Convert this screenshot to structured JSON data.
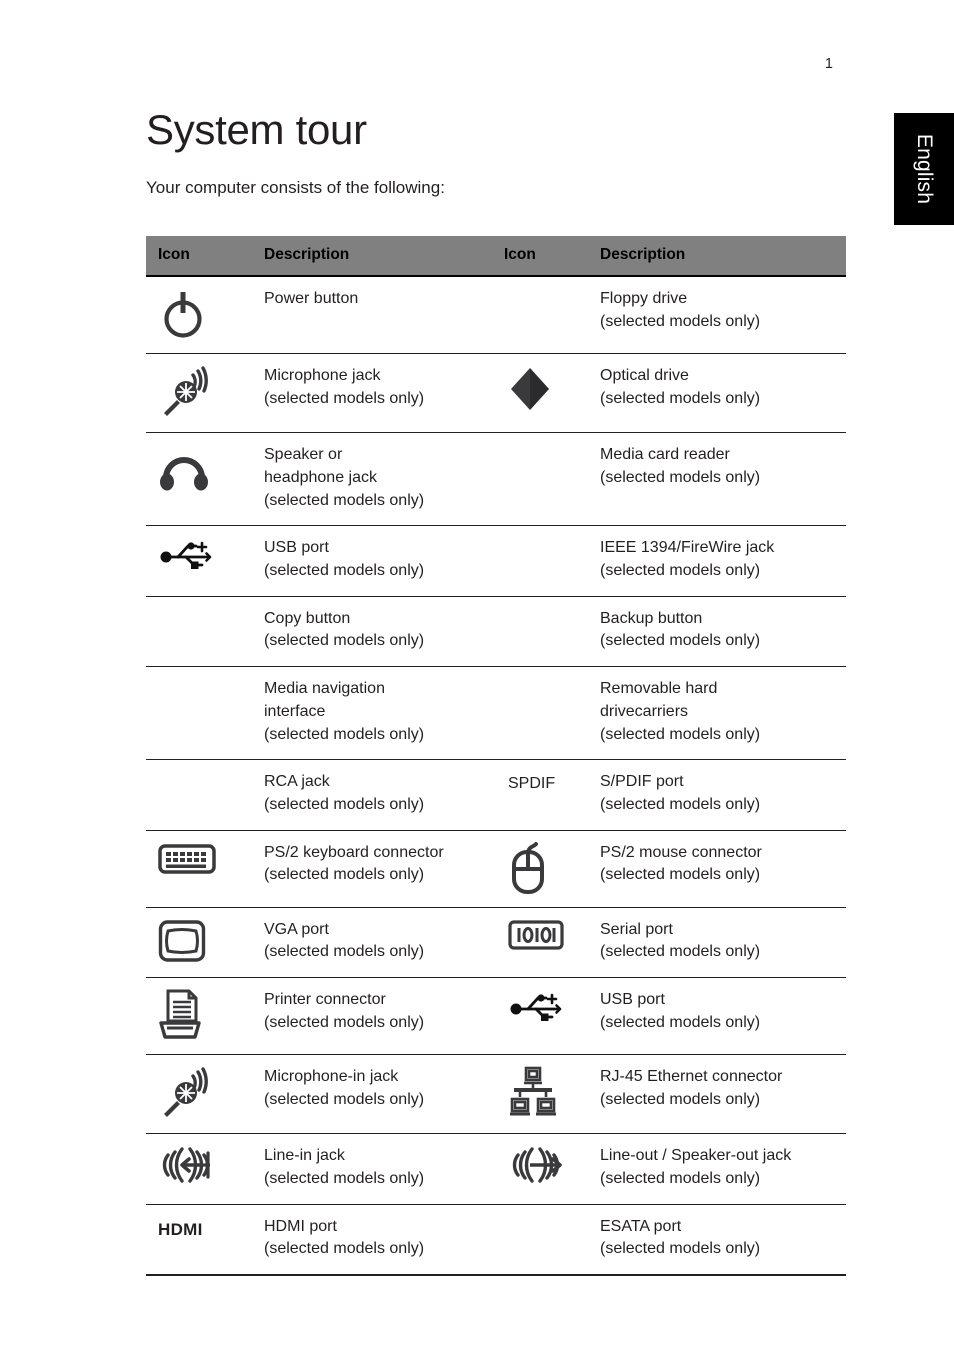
{
  "page": {
    "number": "1",
    "language_tab": "English",
    "title": "System tour",
    "intro": "Your computer consists of the following:"
  },
  "table": {
    "headers": {
      "icon1": "Icon",
      "desc1": "Description",
      "icon2": "Icon",
      "desc2": "Description"
    },
    "rows": [
      {
        "icon1": "power-button-icon",
        "desc1": [
          "Power button"
        ],
        "icon2": "",
        "desc2": [
          "Floppy drive",
          "(selected models only)"
        ]
      },
      {
        "icon1": "microphone-jack-icon",
        "desc1": [
          "Microphone jack",
          "(selected models only)"
        ],
        "icon2": "optical-drive-icon",
        "desc2": [
          "Optical drive",
          "(selected models only)"
        ]
      },
      {
        "icon1": "headphone-jack-icon",
        "desc1": [
          "Speaker or",
          "headphone jack",
          "(selected models only)"
        ],
        "icon2": "",
        "desc2": [
          "Media card reader",
          "(selected models only)"
        ]
      },
      {
        "icon1": "usb-port-icon",
        "desc1": [
          "USB port",
          "(selected models only)"
        ],
        "icon2": "",
        "desc2": [
          "IEEE 1394/FireWire jack",
          "(selected models only)"
        ]
      },
      {
        "icon1": "",
        "desc1": [
          "Copy button",
          "(selected models only)"
        ],
        "icon2": "",
        "desc2": [
          "Backup button",
          "(selected models only)"
        ]
      },
      {
        "icon1": "",
        "desc1": [
          "Media navigation",
          "interface",
          "(selected models only)"
        ],
        "icon2": "",
        "desc2": [
          "Removable hard",
          "drivecarriers",
          "(selected models only)"
        ]
      },
      {
        "icon1": "",
        "desc1": [
          "RCA jack",
          "(selected models only)"
        ],
        "icon2": "spdif-text-icon",
        "icon2_text": "SPDIF",
        "desc2": [
          "S/PDIF port",
          "(selected models only)"
        ]
      },
      {
        "icon1": "ps2-keyboard-icon",
        "desc1": [
          "PS/2 keyboard connector",
          "(selected models only)"
        ],
        "icon2": "ps2-mouse-icon",
        "desc2": [
          "PS/2 mouse connector",
          "(selected models only)"
        ]
      },
      {
        "icon1": "vga-port-icon",
        "desc1": [
          "VGA port",
          "(selected models only)"
        ],
        "icon2": "serial-port-icon",
        "desc2": [
          "Serial port",
          "(selected models only)"
        ]
      },
      {
        "icon1": "printer-connector-icon",
        "desc1": [
          "Printer connector",
          "(selected models only)"
        ],
        "icon2": "usb-port-icon",
        "desc2": [
          "USB port",
          "(selected models only)"
        ]
      },
      {
        "icon1": "microphone-in-jack-icon",
        "desc1": [
          "Microphone-in jack",
          "(selected models only)"
        ],
        "icon2": "rj45-ethernet-icon",
        "desc2": [
          "RJ-45 Ethernet connector",
          "(selected models only)"
        ]
      },
      {
        "icon1": "line-in-jack-icon",
        "desc1": [
          "Line-in jack",
          "(selected models only)"
        ],
        "icon2": "line-out-jack-icon",
        "desc2": [
          "Line-out / Speaker-out jack",
          "(selected models only)"
        ]
      },
      {
        "icon1": "hdmi-text-icon",
        "icon1_text": "HDMI",
        "desc1": [
          "HDMI port",
          "(selected models only)"
        ],
        "icon2": "",
        "desc2": [
          "ESATA port",
          "(selected models only)"
        ]
      }
    ]
  },
  "colors": {
    "header_background": "#808080",
    "text": "#231f20",
    "icon": "#3a3a3c",
    "tab_background": "#000000",
    "tab_text": "#ffffff"
  }
}
